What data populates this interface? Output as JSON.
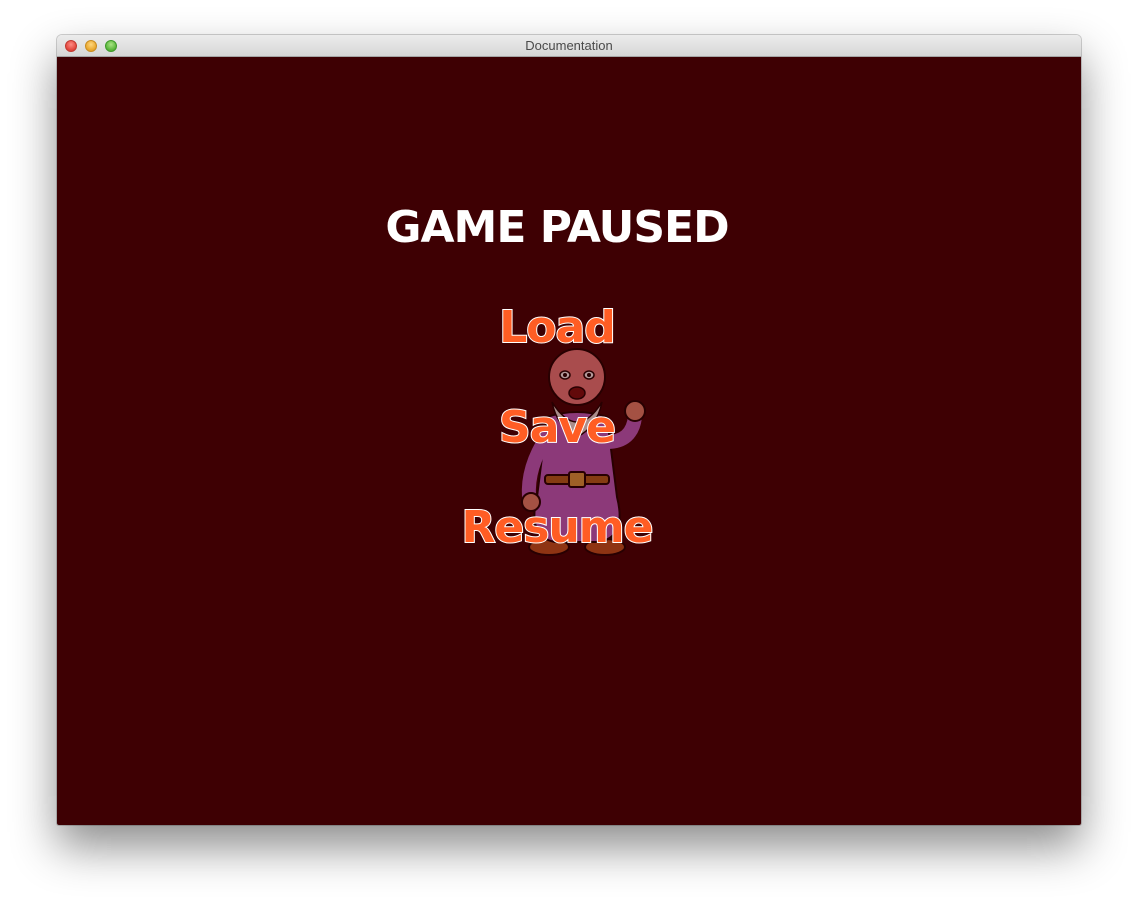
{
  "window": {
    "title": "Documentation"
  },
  "pause_menu": {
    "heading": "GAME PAUSED",
    "items": [
      {
        "label": "Load"
      },
      {
        "label": "Save"
      },
      {
        "label": "Resume"
      }
    ]
  },
  "colors": {
    "background": "#3e0003",
    "heading": "#ffffff",
    "menu_item": "#ff5d24",
    "menu_item_outline": "#ffffff"
  },
  "icons": {
    "character": "old-man-character"
  }
}
